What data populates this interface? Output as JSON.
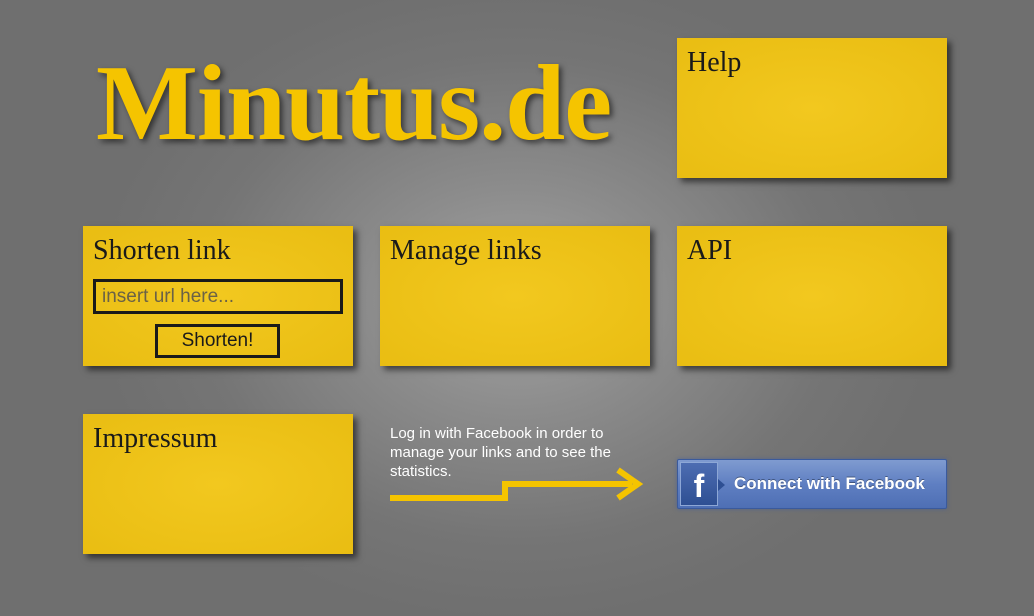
{
  "header": {
    "logo_text": "Minutus.de"
  },
  "tiles": {
    "help": {
      "title": "Help"
    },
    "shorten": {
      "title": "Shorten link",
      "input_value": "",
      "input_placeholder": "insert url here...",
      "button_label": "Shorten!"
    },
    "manage": {
      "title": "Manage links"
    },
    "api": {
      "title": "API"
    },
    "impressum": {
      "title": "Impressum"
    }
  },
  "facebook": {
    "info_text": "Log in with Facebook in order to manage your links and to see the statistics.",
    "button_label": "Connect with Facebook",
    "icon_letter": "f",
    "icon": "facebook-icon",
    "arrow_icon": "arrow-right-icon"
  },
  "colors": {
    "tile_yellow": "#ebbe13",
    "logo_yellow": "#f5c400",
    "background_gray": "#757575",
    "facebook_blue": "#5f7fc2"
  }
}
